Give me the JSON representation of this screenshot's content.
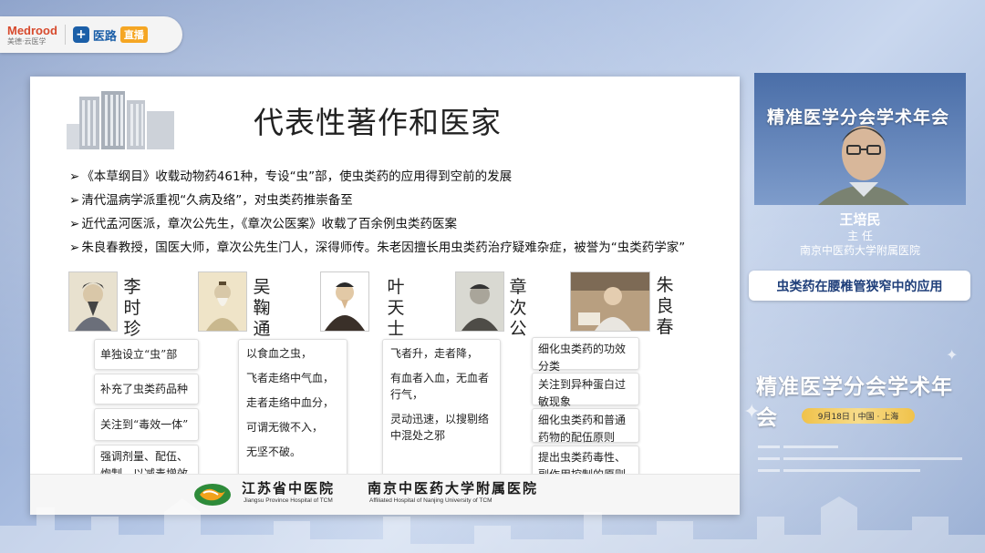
{
  "header": {
    "medrood_logo": "Medrood",
    "medrood_sub": "美德·云医学",
    "yilu_brand": "医路",
    "live_badge": "直播"
  },
  "slide": {
    "title": "代表性著作和医家",
    "bullets": [
      "《本草纲目》收载动物药461种，专设“虫”部，使虫类药的应用得到空前的发展",
      "清代温病学派重视“久病及络”，对虫类药推崇备至",
      "近代孟河医派，章次公先生，《章次公医案》收载了百余例虫类药医案",
      "朱良春教授，国医大师，章次公先生门人，深得师传。朱老因擅长用虫类药治疗疑难杂症，被誉为“虫类药学家”"
    ],
    "physicians": [
      {
        "name": "李时珍"
      },
      {
        "name": "吴鞠通"
      },
      {
        "name": "叶天士"
      },
      {
        "name": "章次公"
      },
      {
        "name": "朱良春"
      }
    ],
    "col1": [
      "单独设立“虫”部",
      "补充了虫类药品种",
      "关注到“毒效一体”",
      "强调剂量、配伍、炮制，以减毒增效"
    ],
    "col2": [
      "以食血之虫，",
      "飞者走络中气血，",
      "走者走络中血分，",
      "可谓无微不入，",
      "无坚不破。"
    ],
    "col3": [
      "飞者升，走者降，",
      "有血者入血，无血者行气，",
      "灵动迅速，以搜剔络中混处之邪"
    ],
    "col4": [
      "细化虫类药的功效分类",
      "关注到异种蛋白过敏现象",
      "细化虫类药和普通药物的配伍原则",
      "提出虫类药毒性、副作用控制的原则"
    ],
    "footer": {
      "hospital1": "江苏省中医院",
      "hospital1_en": "Jiangsu Province Hospital of TCM",
      "hospital2": "南京中医药大学附属医院",
      "hospital2_en": "Affiliated Hospital of Nanjing University of TCM"
    }
  },
  "sidebar": {
    "video_title": "精准医学分会学术年会",
    "speaker_name": "王培民",
    "speaker_role": "主 任",
    "speaker_org": "南京中医药大学附属医院",
    "topic": "虫类药在腰椎管狭窄中的应用",
    "meeting_title": "精准医学分会学术年会",
    "date_location": "9月18日 | 中国 · 上海"
  }
}
